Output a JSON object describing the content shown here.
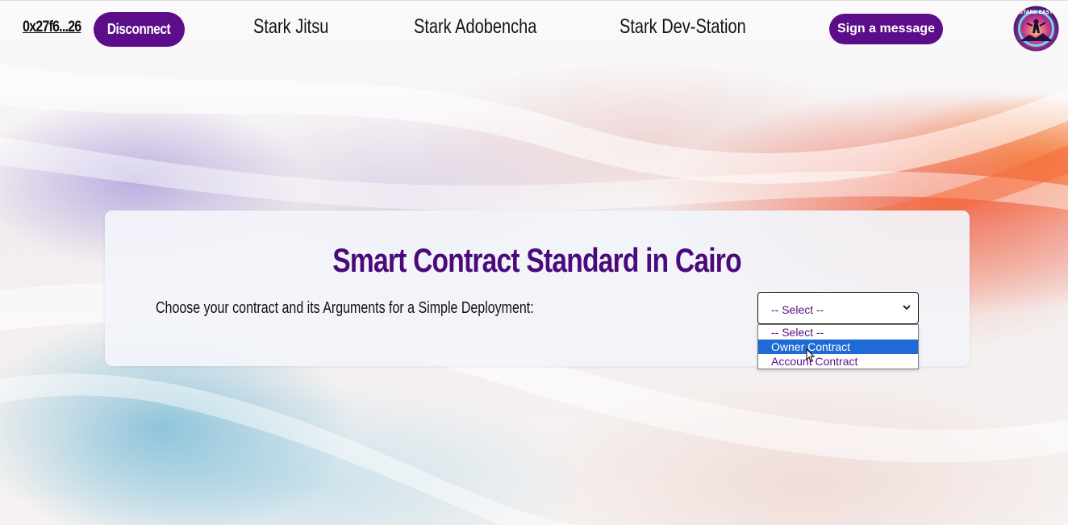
{
  "header": {
    "wallet_address": "0x27f6...26",
    "disconnect_label": "Disconnect",
    "nav": [
      "Stark Jitsu",
      "Stark Adobencha",
      "Stark Dev-Station"
    ],
    "sign_label": "Sign a message",
    "logo_text": "STARK EASY"
  },
  "card": {
    "title": "Smart Contract Standard in Cairo",
    "prompt": "Choose your contract and its Arguments for a Simple Deployment:",
    "select_value": "-- Select --",
    "options": [
      "-- Select --",
      "Owner Contract",
      "Account Contract"
    ],
    "highlighted_option": "Owner Contract"
  },
  "colors": {
    "brand_purple": "#5c0d8a",
    "title_purple": "#4b0a7a",
    "highlight_blue": "#1f6ad4"
  }
}
